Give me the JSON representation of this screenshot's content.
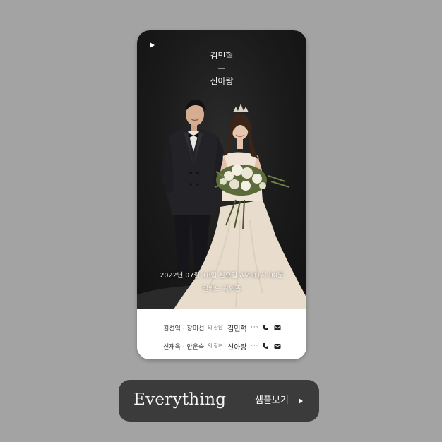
{
  "card": {
    "groom_name": "김민혁",
    "separator": "—",
    "bride_name": "신아랑",
    "date_time": "2022년 07월 18일 월요일 AM 01시 00분",
    "venue": "밀카드 웨딩홀",
    "play_icon": "play-icon"
  },
  "families": [
    {
      "parents": "김선익 · 장미선",
      "relation": "의 장남",
      "child": "김민혁",
      "more": "···",
      "icons": [
        "phone-icon",
        "mail-icon"
      ]
    },
    {
      "parents": "신재욱 · 안운숙",
      "relation": "의 장녀",
      "child": "신아랑",
      "more": "···",
      "icons": [
        "phone-icon",
        "mail-icon"
      ]
    }
  ],
  "cta": {
    "title": "Everything",
    "label": "샘플보기",
    "icon": "play-arrow-icon"
  },
  "colors": {
    "background": "#a3a3a3",
    "photo_bg": "#1a1a1a",
    "cta_bg": "#3b3b3b",
    "dress": "#e8dccd"
  }
}
